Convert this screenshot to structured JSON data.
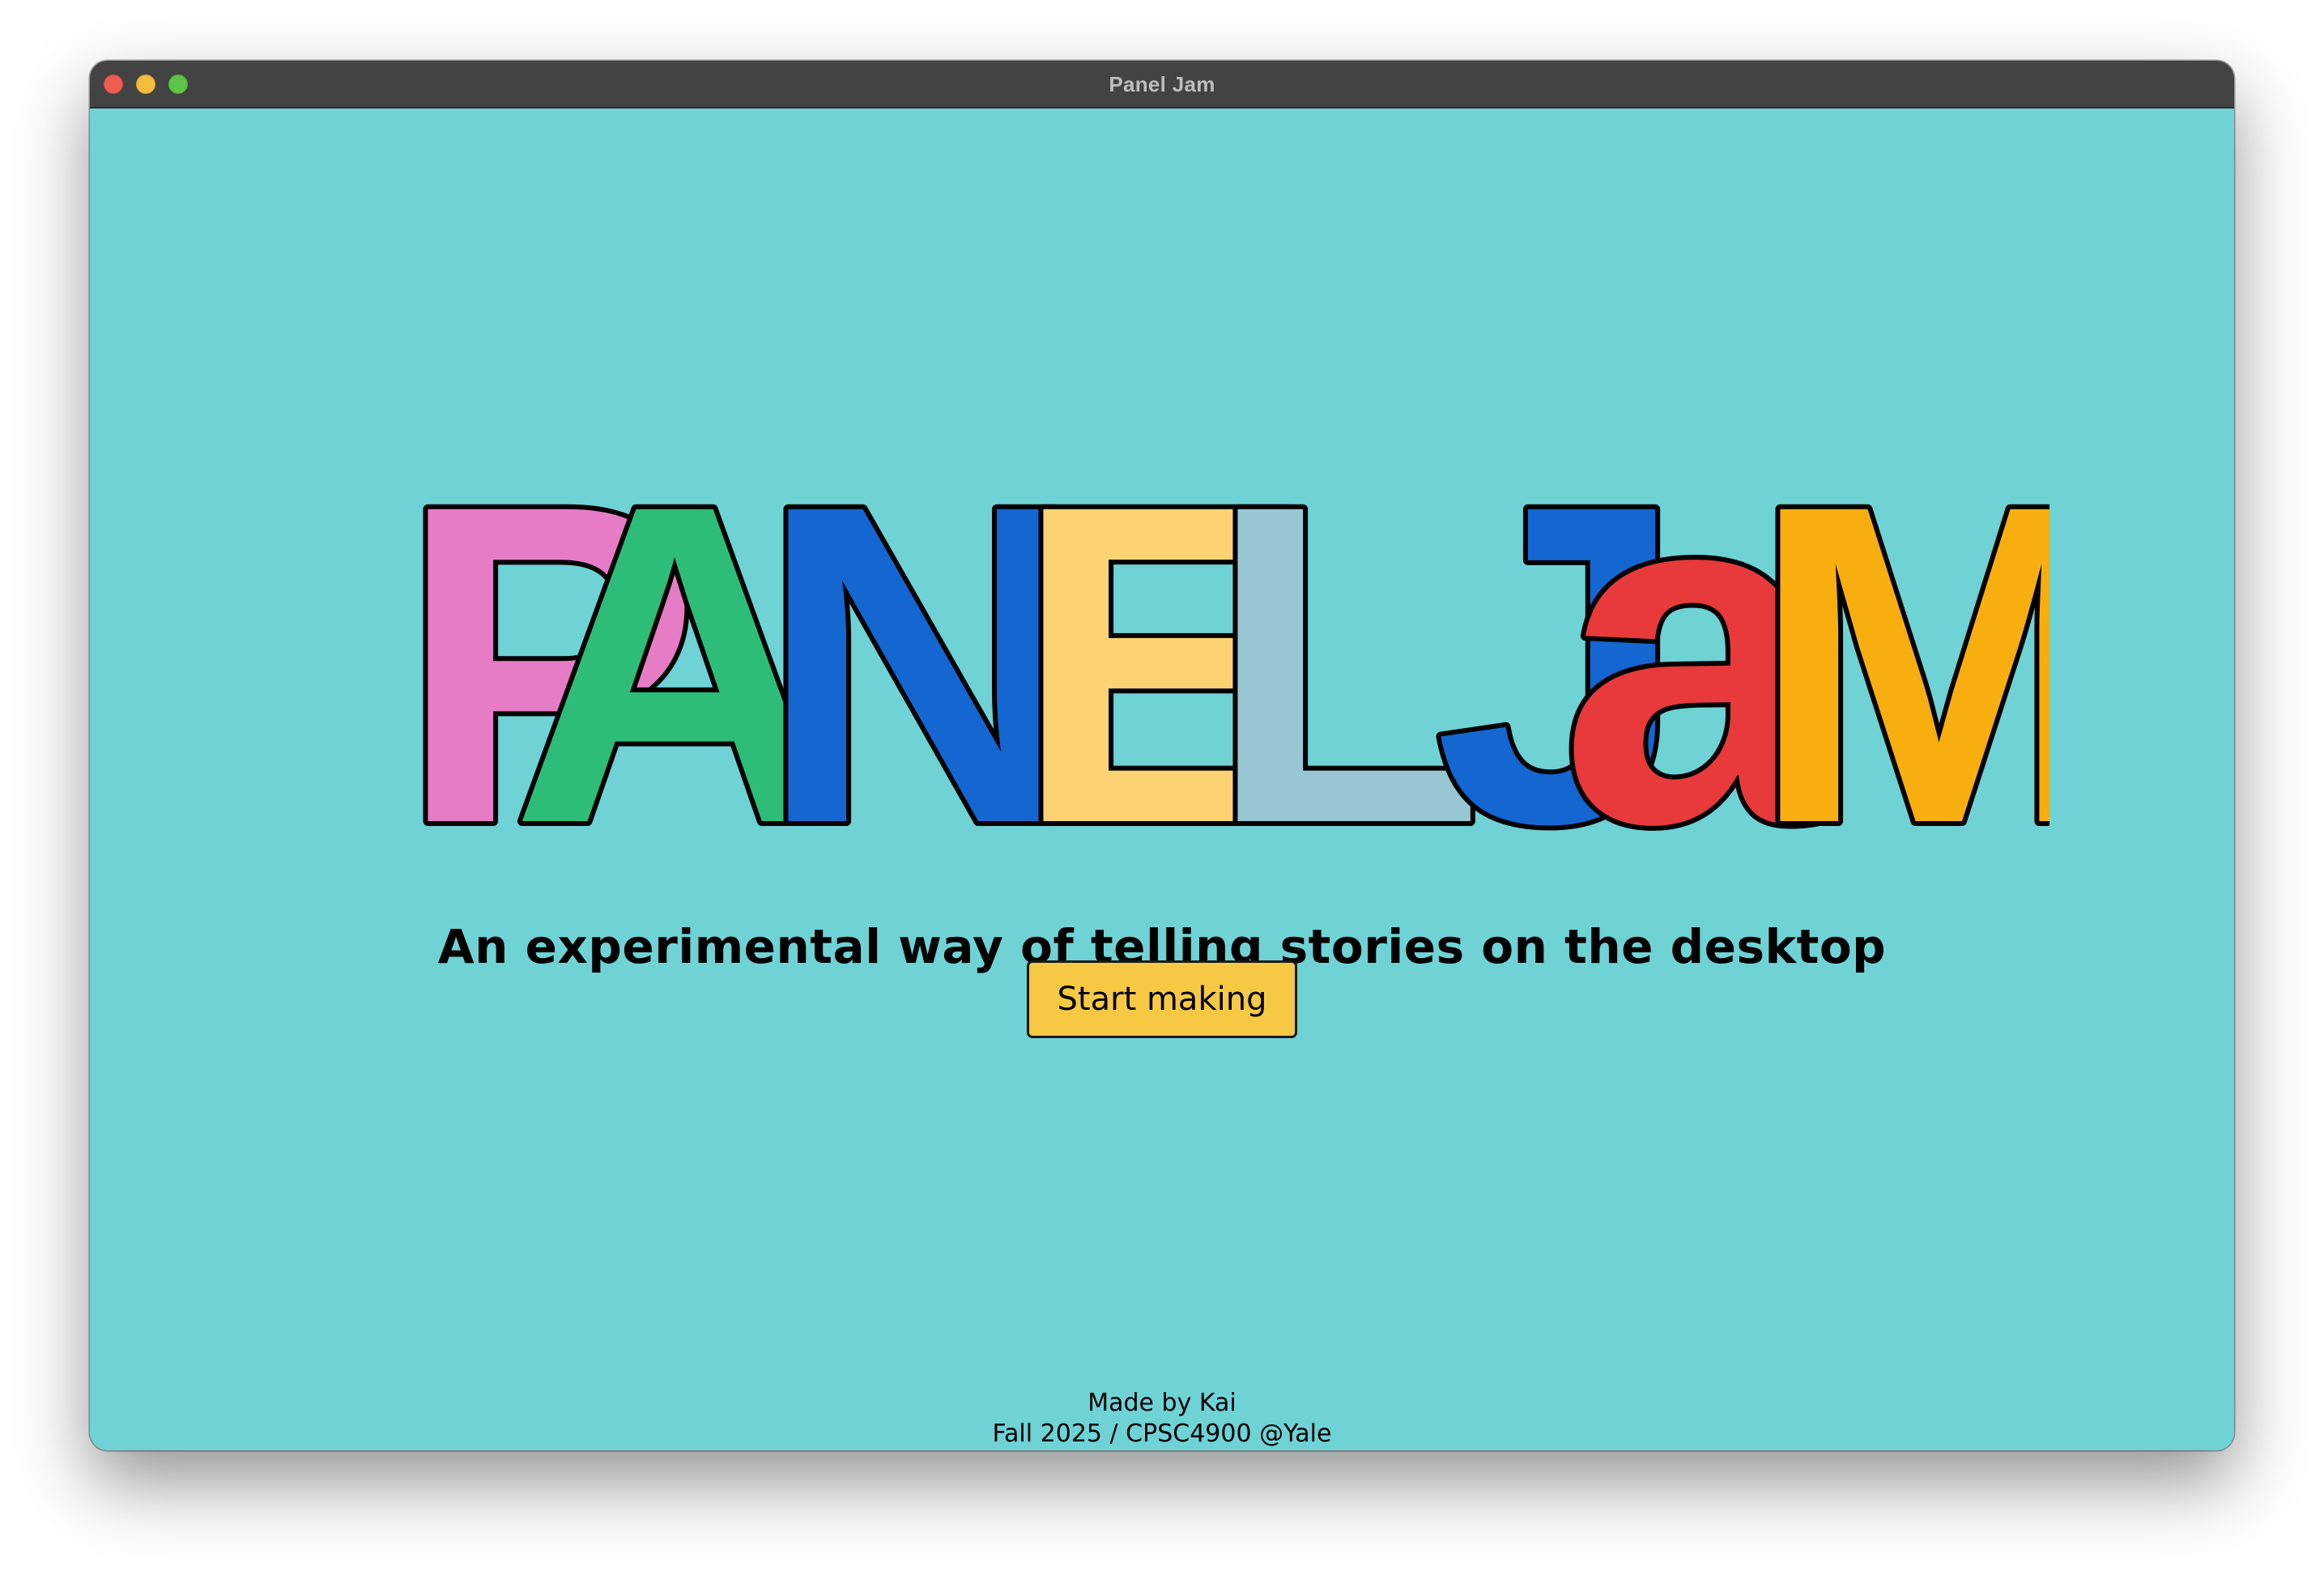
{
  "window": {
    "title": "Panel Jam"
  },
  "logo": {
    "letters": [
      {
        "char": "P",
        "color": "#e77cc6"
      },
      {
        "char": "A",
        "color": "#2dbd78"
      },
      {
        "char": "N",
        "color": "#1466d0"
      },
      {
        "char": "E",
        "color": "#fbd372"
      },
      {
        "char": "L",
        "color": "#98c6d2"
      },
      {
        "char": "J",
        "color": "#1466d0"
      },
      {
        "char": "a",
        "color": "#e8393b"
      },
      {
        "char": "M",
        "color": "#f9ae10"
      }
    ]
  },
  "main": {
    "tagline": "An experimental way of telling stories on the desktop",
    "start_label": "Start making"
  },
  "footer": {
    "line1": "Made by Kai",
    "line2": "Fall 2025 / CPSC4900 @Yale"
  },
  "colors": {
    "background": "#6fd2d5",
    "titlebar": "#434343",
    "button": "#f6c844"
  }
}
